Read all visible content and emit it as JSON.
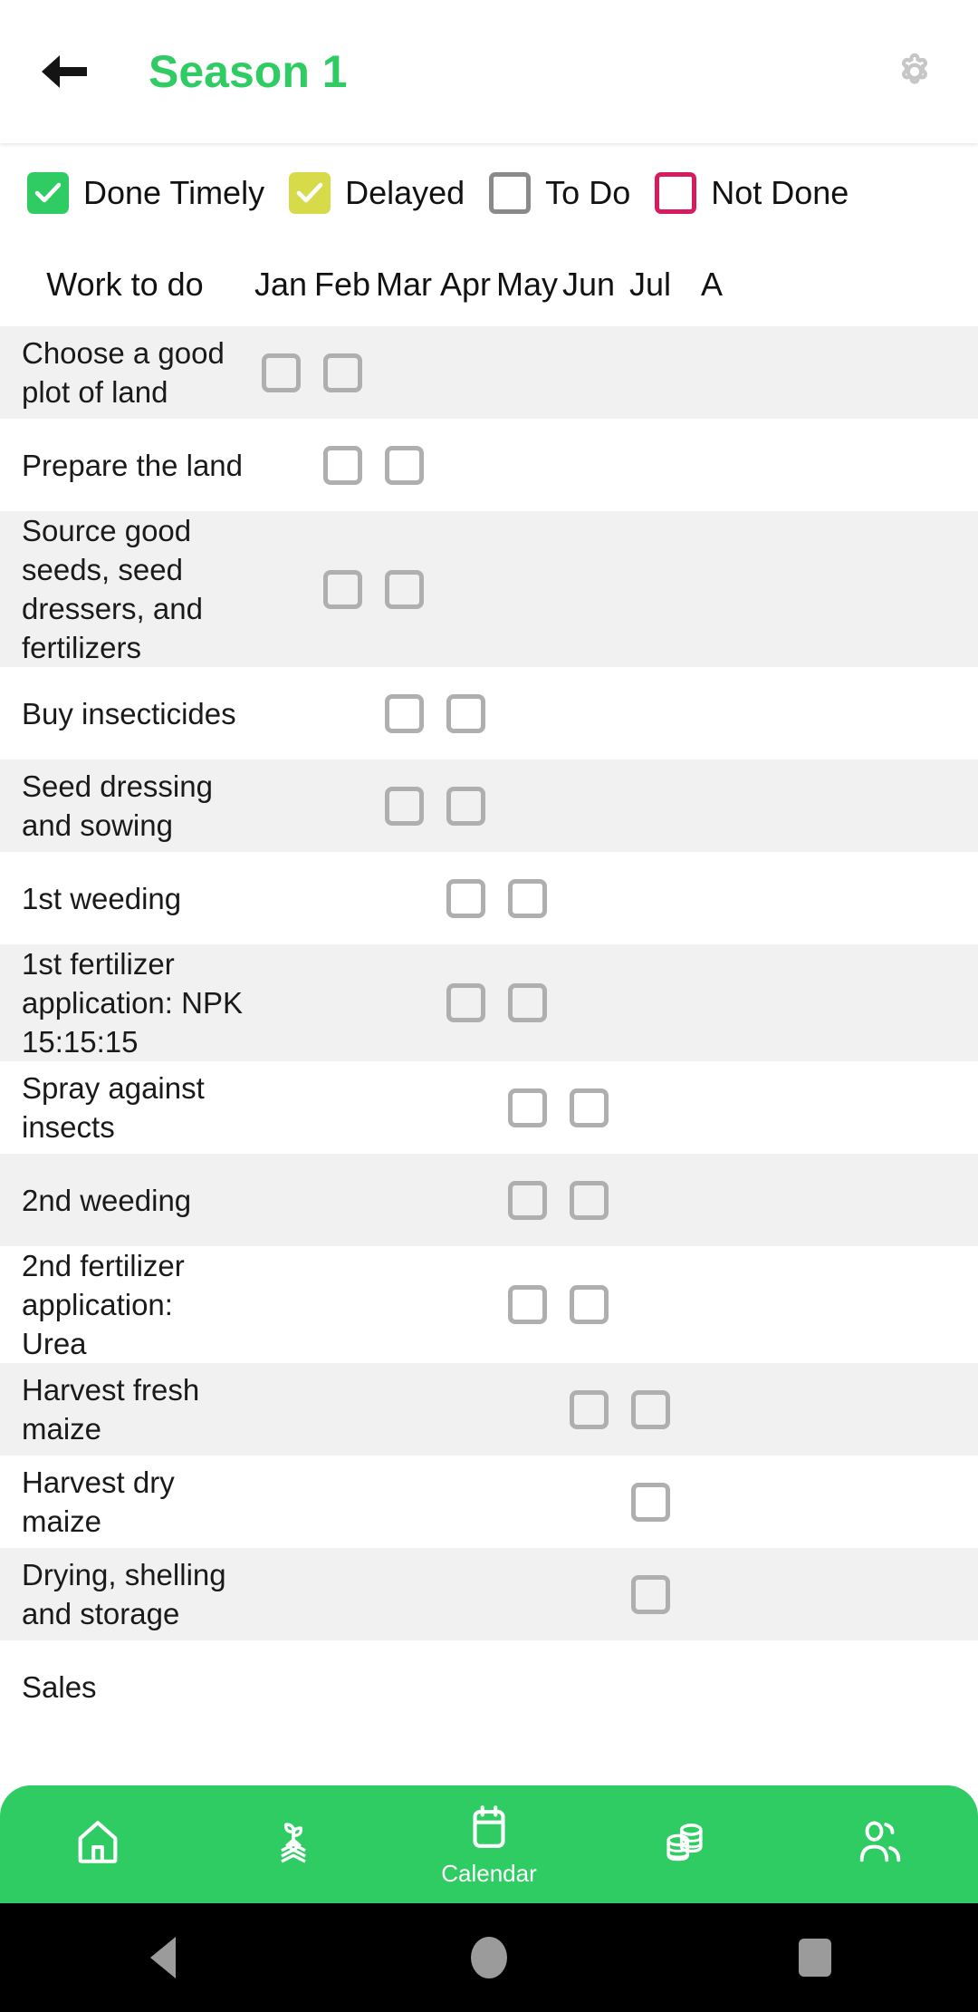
{
  "appbar": {
    "back_icon": "arrow-left-icon",
    "title": "Season 1",
    "settings_icon": "gear-icon",
    "title_color": "#2ECC62"
  },
  "legend": {
    "items": [
      {
        "label": "Done Timely",
        "state": "checked",
        "color": "#2ECC62",
        "icon": "checkbox-checked-icon"
      },
      {
        "label": "Delayed",
        "state": "checked",
        "color": "#D7DB4A",
        "icon": "checkbox-checked-icon"
      },
      {
        "label": "To Do",
        "state": "empty",
        "color": "#8A8A8A",
        "icon": "checkbox-empty-icon"
      },
      {
        "label": "Not Done",
        "state": "empty",
        "color": "#D81B60",
        "icon": "checkbox-empty-icon"
      }
    ]
  },
  "table": {
    "task_column_header": "Work to do",
    "months": [
      "Jan",
      "Feb",
      "Mar",
      "Apr",
      "May",
      "Jun",
      "Jul",
      "A"
    ],
    "rows": [
      {
        "task": "Choose a good plot of land",
        "checks": [
          1,
          1,
          0,
          0,
          0,
          0,
          0,
          0
        ]
      },
      {
        "task": "Prepare the land",
        "checks": [
          0,
          1,
          1,
          0,
          0,
          0,
          0,
          0
        ]
      },
      {
        "task": "Source good seeds, seed dressers, and fertilizers",
        "checks": [
          0,
          1,
          1,
          0,
          0,
          0,
          0,
          0
        ]
      },
      {
        "task": "Buy insecticides",
        "checks": [
          0,
          0,
          1,
          1,
          0,
          0,
          0,
          0
        ]
      },
      {
        "task": "Seed dressing and sowing",
        "checks": [
          0,
          0,
          1,
          1,
          0,
          0,
          0,
          0
        ]
      },
      {
        "task": "1st weeding",
        "checks": [
          0,
          0,
          0,
          1,
          1,
          0,
          0,
          0
        ]
      },
      {
        "task": "1st fertilizer application: NPK 15:15:15",
        "checks": [
          0,
          0,
          0,
          1,
          1,
          0,
          0,
          0
        ]
      },
      {
        "task": "Spray against insects",
        "checks": [
          0,
          0,
          0,
          0,
          1,
          1,
          0,
          0
        ]
      },
      {
        "task": "2nd weeding",
        "checks": [
          0,
          0,
          0,
          0,
          1,
          1,
          0,
          0
        ]
      },
      {
        "task": "2nd fertilizer application: Urea",
        "checks": [
          0,
          0,
          0,
          0,
          1,
          1,
          0,
          0
        ]
      },
      {
        "task": "Harvest fresh maize",
        "checks": [
          0,
          0,
          0,
          0,
          0,
          1,
          1,
          0
        ]
      },
      {
        "task": "Harvest dry maize",
        "checks": [
          0,
          0,
          0,
          0,
          0,
          0,
          1,
          0
        ]
      },
      {
        "task": "Drying, shelling and storage",
        "checks": [
          0,
          0,
          0,
          0,
          0,
          0,
          1,
          0
        ]
      },
      {
        "task": "Sales",
        "checks": [
          0,
          0,
          0,
          0,
          0,
          0,
          0,
          0
        ]
      }
    ]
  },
  "bottom_nav": {
    "background": "#2ECC62",
    "items": [
      {
        "label": "",
        "icon": "home-icon",
        "active": false
      },
      {
        "label": "",
        "icon": "seedling-icon",
        "active": false
      },
      {
        "label": "Calendar",
        "icon": "calendar-icon",
        "active": true
      },
      {
        "label": "",
        "icon": "coins-icon",
        "active": false
      },
      {
        "label": "",
        "icon": "people-icon",
        "active": false
      }
    ]
  },
  "system_nav": {
    "items": [
      {
        "icon": "back-triangle-icon"
      },
      {
        "icon": "home-circle-icon"
      },
      {
        "icon": "recents-square-icon"
      }
    ]
  }
}
